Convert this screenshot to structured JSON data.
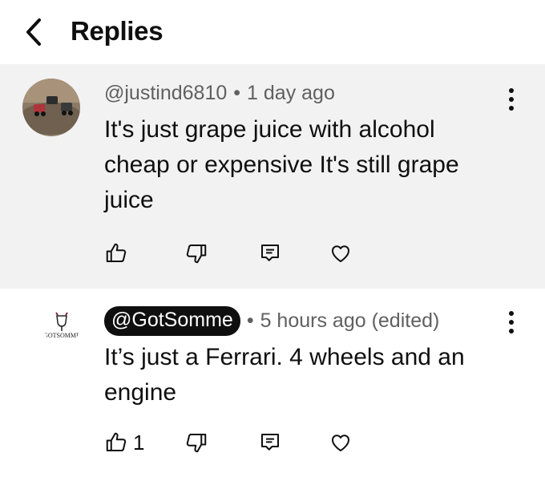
{
  "header": {
    "title": "Replies",
    "back_icon": "chevron-left-icon"
  },
  "comments": [
    {
      "author": "@justind6810",
      "time": "1 day ago",
      "text": "It's just grape juice with alcohol cheap or expensive It's still grape juice",
      "likes": "",
      "highlighted": true,
      "author_is_creator": false
    },
    {
      "author": "@GotSomme",
      "time": "5 hours ago (edited)",
      "text": "It’s just a Ferrari. 4 wheels and an engine",
      "likes": "1",
      "highlighted": false,
      "author_is_creator": true,
      "avatar_logo_text": "GOTSOMME"
    }
  ],
  "icons": {
    "like": "thumbs-up-icon",
    "dislike": "thumbs-down-icon",
    "reply": "comment-icon",
    "heart": "heart-icon",
    "more": "more-vertical-icon"
  },
  "colors": {
    "highlight_bg": "#f2f2f2",
    "text": "#0f0f0f",
    "meta": "#606060",
    "pill_bg": "#0f0f0f"
  }
}
